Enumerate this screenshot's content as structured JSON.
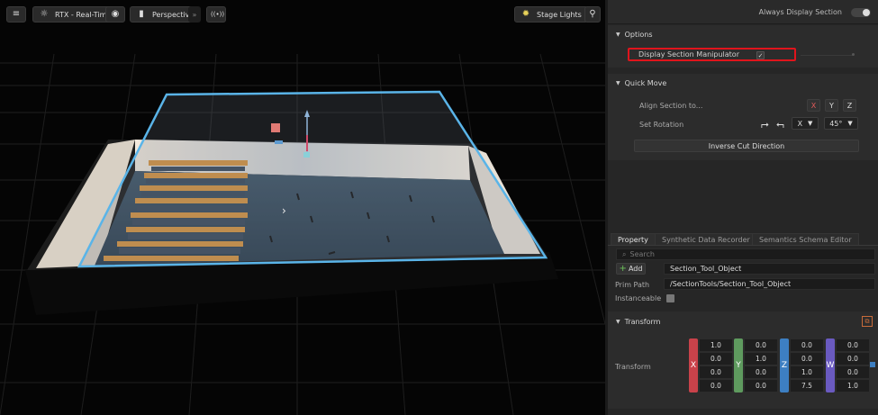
{
  "viewport": {
    "toolbar": {
      "renderer": "RTX - Real-Time",
      "camera": "Perspective",
      "stage_lights": "Stage Lights"
    }
  },
  "panel": {
    "always_display_section": "Always Display Section",
    "options": {
      "title": "Options",
      "display_section_manipulator": "Display Section Manipulator",
      "display_section_manipulator_checked": true
    },
    "quick_move": {
      "title": "Quick Move",
      "align_section_label": "Align Section to...",
      "align_buttons": [
        "X",
        "Y",
        "Z"
      ],
      "set_rotation_label": "Set Rotation",
      "rotation_axis": "X",
      "rotation_angle": "45°",
      "inverse_cut_label": "Inverse Cut Direction"
    },
    "tabs": [
      "Property",
      "Synthetic Data Recorder",
      "Semantics Schema Editor"
    ],
    "active_tab": "Property",
    "property": {
      "search_placeholder": "Search",
      "add_label": "Add",
      "object_name": "Section_Tool_Object",
      "prim_path_label": "Prim Path",
      "prim_path": "/SectionTools/Section_Tool_Object",
      "instanceable_label": "Instanceable"
    },
    "transform": {
      "title": "Transform",
      "row_label": "Transform",
      "axes": [
        {
          "name": "X",
          "color": "#c9424a",
          "values": [
            "1.0",
            "0.0",
            "0.0",
            "0.0"
          ]
        },
        {
          "name": "Y",
          "color": "#5e9a5e",
          "values": [
            "0.0",
            "1.0",
            "0.0",
            "0.0"
          ]
        },
        {
          "name": "Z",
          "color": "#3d7fc2",
          "values": [
            "0.0",
            "0.0",
            "1.0",
            "7.5"
          ]
        },
        {
          "name": "W",
          "color": "#6a5ac0",
          "values": [
            "0.0",
            "0.0",
            "0.0",
            "1.0"
          ]
        }
      ]
    }
  },
  "colors": {
    "accent_highlight": "#e0141c",
    "section_box": "#5ab4e8"
  }
}
